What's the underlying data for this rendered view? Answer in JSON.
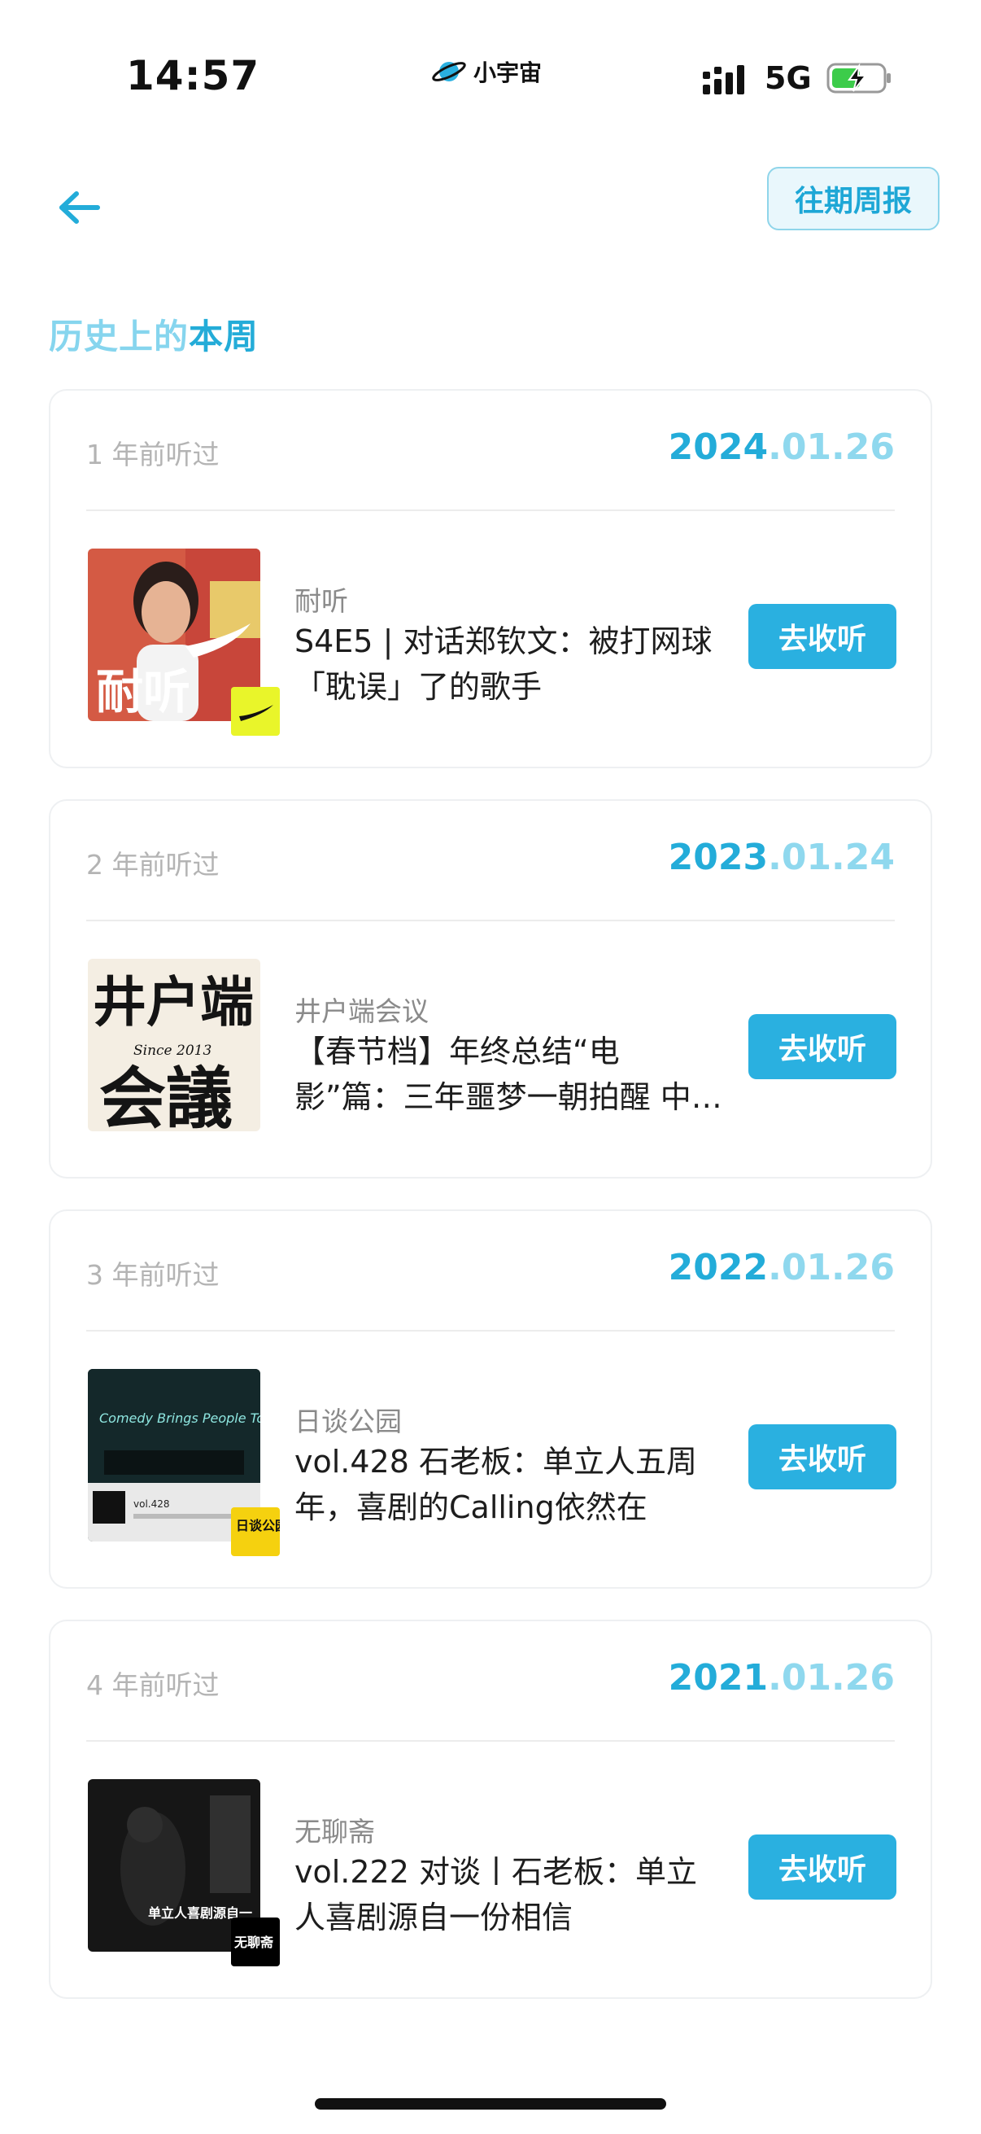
{
  "status_bar": {
    "time": "14:57",
    "app_brand": "小宇宙",
    "network": "5G",
    "icons": [
      "planet-logo-icon",
      "signal-icon",
      "battery-charging-icon"
    ]
  },
  "top_bar": {
    "back_icon": "arrow-left-icon",
    "past_weekly_label": "往期周报"
  },
  "section": {
    "title_light": "历史上的",
    "title_strong": "本周"
  },
  "colors": {
    "accent": "#2ab0e0",
    "accent_light": "#8fd8ee",
    "muted_text": "#b4b4b4"
  },
  "cards": [
    {
      "ago": "1 年前听过",
      "date_year": "2024",
      "date_md": ".01.26",
      "podcast": "耐听",
      "title": "S4E5 | 对话郑钦文：被打网球「耽误」了的歌手",
      "button": "去收听",
      "cover_text": "耐听"
    },
    {
      "ago": "2 年前听过",
      "date_year": "2023",
      "date_md": ".01.24",
      "podcast": "井户端会议",
      "title": "【春节档】年终总结“电影”篇：三年噩梦一朝拍醒 中…",
      "button": "去收听",
      "cover_line1": "井户端",
      "cover_line2": "会議",
      "cover_since": "Since 2013"
    },
    {
      "ago": "3 年前听过",
      "date_year": "2022",
      "date_md": ".01.26",
      "podcast": "日谈公园",
      "title": "vol.428 石老板：单立人五周年，喜剧的Calling依然在",
      "button": "去收听",
      "cover_neon": "Comedy Brings People Together",
      "cover_logo": "日谈公园"
    },
    {
      "ago": "4 年前听过",
      "date_year": "2021",
      "date_md": ".01.26",
      "podcast": "无聊斋",
      "title": "vol.222 对谈丨石老板：单立人喜剧源自一份相信",
      "button": "去收听",
      "cover_caption": "单立人喜剧源自一",
      "cover_logo": "无聊斋"
    }
  ]
}
